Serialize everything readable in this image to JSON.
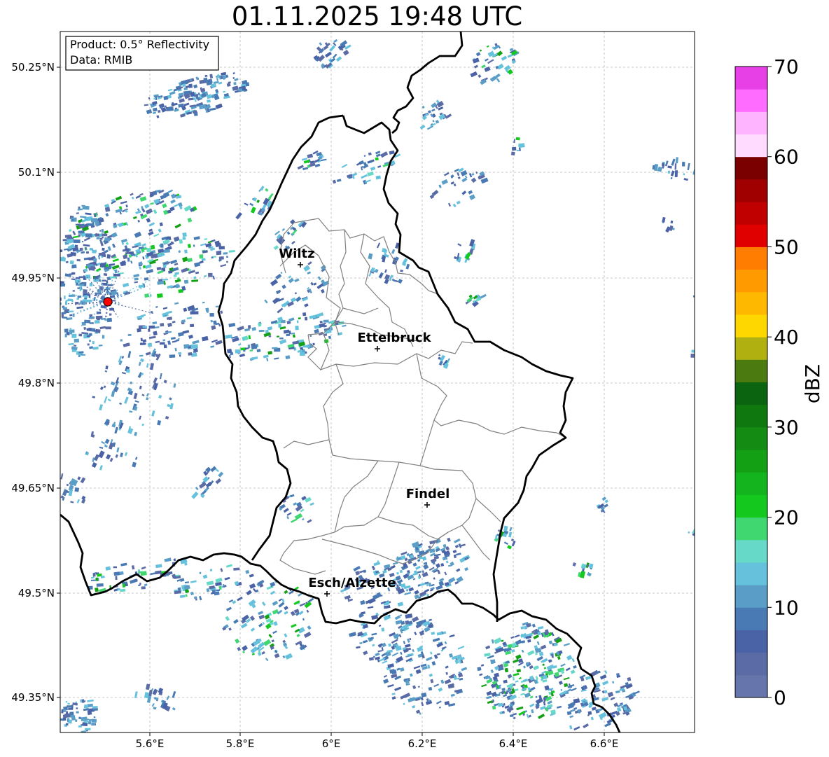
{
  "title": "01.11.2025 19:48 UTC",
  "info_box": {
    "product": "Product: 0.5° Reflectivity",
    "data": "Data: RMIB"
  },
  "map": {
    "lon_ticks": [
      "5.6°E",
      "5.8°E",
      "6°E",
      "6.2°E",
      "6.4°E",
      "6.6°E"
    ],
    "lat_ticks": [
      "50.25°N",
      "50.1°N",
      "49.95°N",
      "49.8°N",
      "49.65°N",
      "49.5°N",
      "49.35°N"
    ],
    "cities": [
      {
        "name": "Wiltz"
      },
      {
        "name": "Ettelbruck"
      },
      {
        "name": "Findel"
      },
      {
        "name": "Esch/Alzette"
      }
    ],
    "radar_site_color": "#ff0000"
  },
  "colorbar": {
    "label": "dBZ",
    "ticks": [
      "70",
      "60",
      "50",
      "40",
      "30",
      "20",
      "10",
      "0"
    ],
    "min": 0,
    "max": 70,
    "step": 2.5,
    "colors": [
      "#6675ab",
      "#5a6ba6",
      "#4a63a6",
      "#4a7ab3",
      "#5a9ec8",
      "#66c2dc",
      "#66d9c8",
      "#40d670",
      "#14c81e",
      "#14b41e",
      "#14a014",
      "#148c14",
      "#0f780f",
      "#0a6410",
      "#4a7a10",
      "#b0b010",
      "#ffd700",
      "#ffb800",
      "#ff9a00",
      "#ff7d00",
      "#e00000",
      "#c00000",
      "#a00000",
      "#7a0000",
      "#ffdcff",
      "#ffb4ff",
      "#ff6cff",
      "#e640e6"
    ]
  }
}
